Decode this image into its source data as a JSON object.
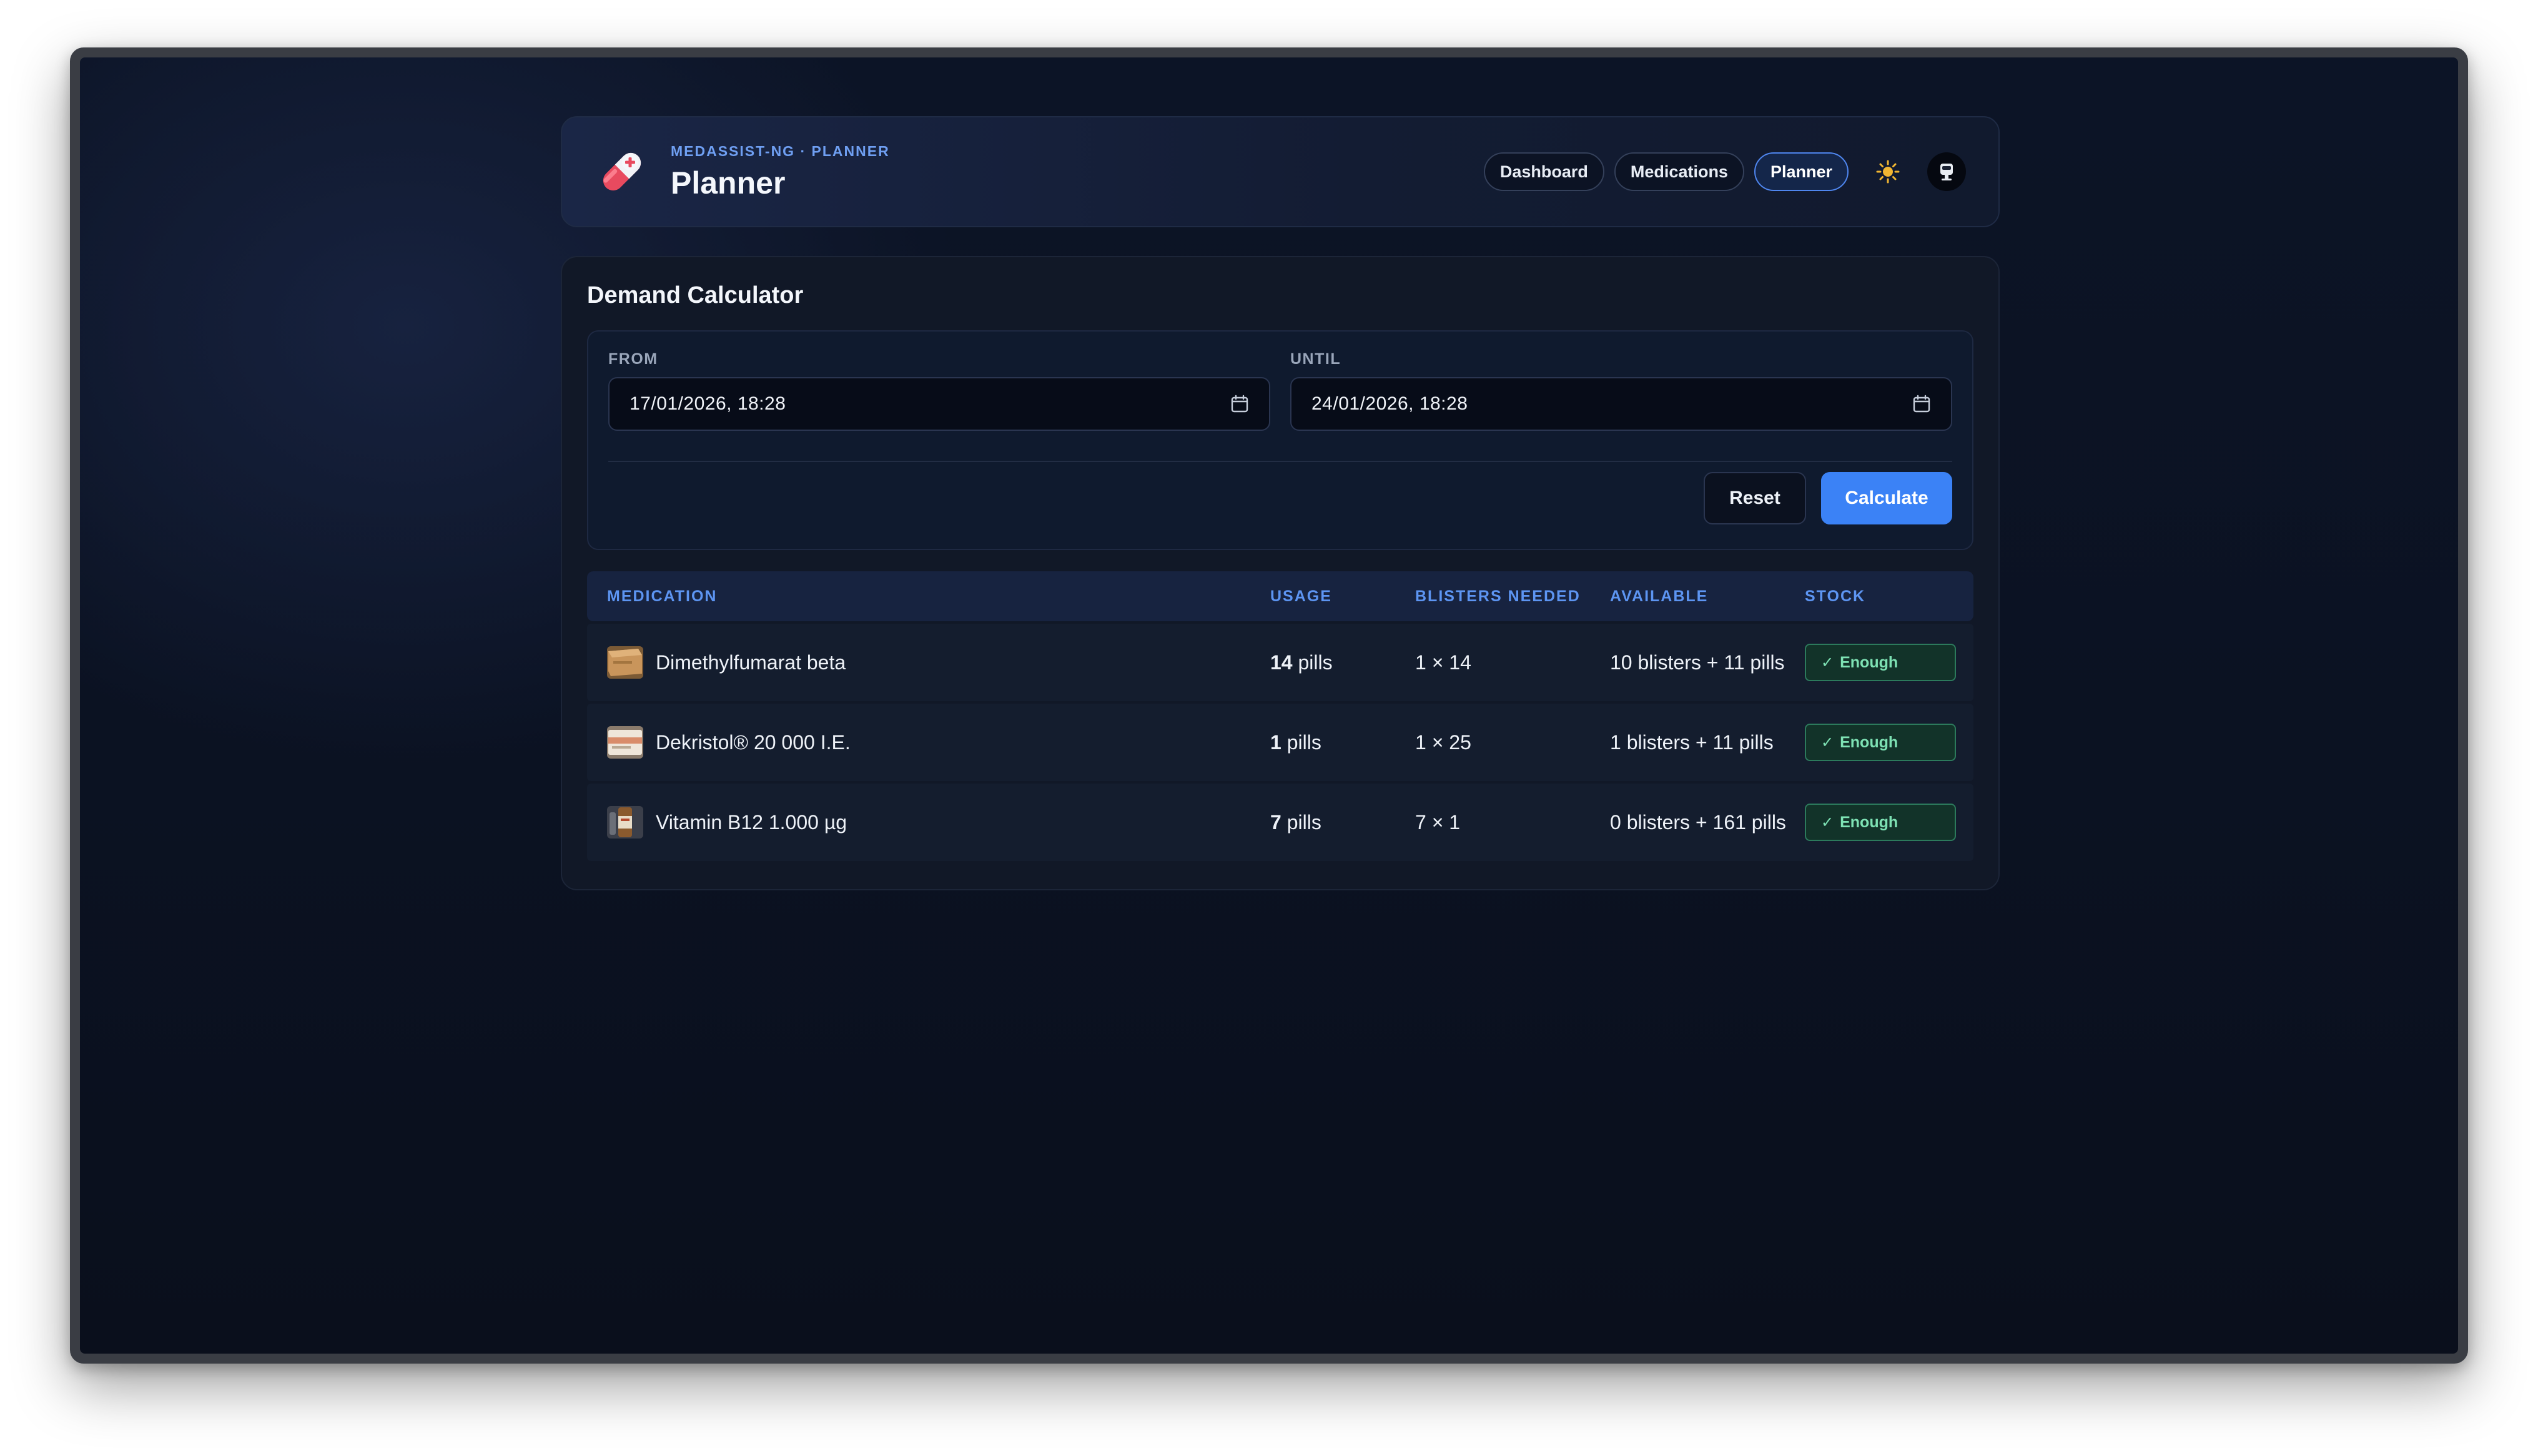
{
  "header": {
    "eyebrow": "MEDASSIST-NG · PLANNER",
    "title": "Planner",
    "nav": [
      {
        "label": "Dashboard",
        "active": false
      },
      {
        "label": "Medications",
        "active": false
      },
      {
        "label": "Planner",
        "active": true
      }
    ],
    "icons": {
      "logo": "pill-icon",
      "theme": "sun-icon",
      "avatar": "avatar-icon"
    }
  },
  "calculator": {
    "title": "Demand Calculator",
    "from": {
      "label": "FROM",
      "value": "17/01/2026,  18:28"
    },
    "until": {
      "label": "UNTIL",
      "value": "24/01/2026,  18:28"
    },
    "reset_label": "Reset",
    "calculate_label": "Calculate"
  },
  "table": {
    "headers": {
      "medication": "MEDICATION",
      "usage": "USAGE",
      "blisters_needed": "BLISTERS NEEDED",
      "available": "AVAILABLE",
      "stock": "STOCK"
    },
    "rows": [
      {
        "name": "Dimethylfumarat beta",
        "usage_count": "14",
        "usage_unit": " pills",
        "blisters": "1 × 14",
        "available": "10 blisters + 11 pills",
        "stock": "Enough"
      },
      {
        "name": "Dekristol® 20 000 I.E.",
        "usage_count": "1",
        "usage_unit": " pills",
        "blisters": "1 × 25",
        "available": "1 blisters + 11 pills",
        "stock": "Enough"
      },
      {
        "name": "Vitamin B12 1.000 µg",
        "usage_count": "7",
        "usage_unit": " pills",
        "blisters": "7 × 1",
        "available": "0 blisters + 161 pills",
        "stock": "Enough"
      }
    ]
  },
  "colors": {
    "accent": "#3b82f6",
    "success": "#7ee2b4",
    "background": "#0b1222"
  }
}
